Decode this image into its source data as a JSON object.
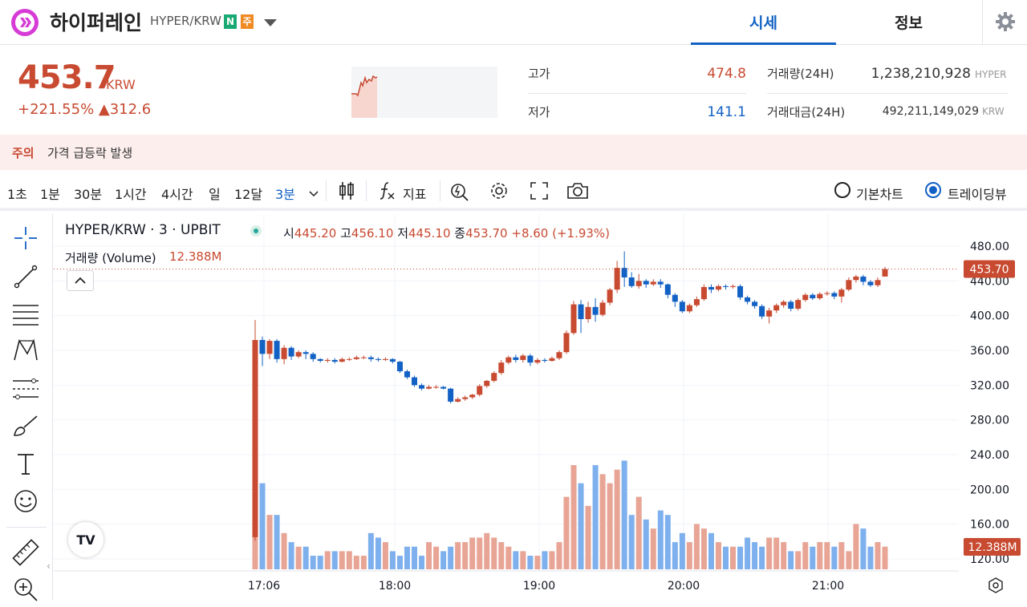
{
  "header": {
    "coin_name": "하이퍼레인",
    "pair": "HYPER/KRW",
    "badge_n": "N",
    "badge_j": "주",
    "tab_price": "시세",
    "tab_info": "정보",
    "brand_color": "#d63bd6",
    "accent_color": "#1261c4"
  },
  "summary": {
    "price": "453.7",
    "price_unit": "KRW",
    "change": "+221.55% ▲312.6",
    "high_label": "고가",
    "high_value": "474.8",
    "low_label": "저가",
    "low_value": "141.1",
    "volume_label": "거래량(24H)",
    "volume_value": "1,238,210,928",
    "volume_unit": "HYPER",
    "amount_label": "거래대금(24H)",
    "amount_value": "492,211,149,029",
    "amount_unit": "KRW",
    "up_color": "#c84a31",
    "down_color": "#1261c4"
  },
  "warning": {
    "title": "주의",
    "text": "가격 급등락 발생"
  },
  "toolbar": {
    "timeframes": [
      "1초",
      "1분",
      "30분",
      "1시간",
      "4시간",
      "일",
      "12달",
      "3분"
    ],
    "indicator_label": "지표",
    "basic_chart": "기본차트",
    "trading_view": "트레이딩뷰",
    "icons": [
      "candle-type-icon",
      "function-icon",
      "compare-icon",
      "gear-icon",
      "fullscreen-icon",
      "camera-icon"
    ]
  },
  "left_tools": [
    "crosshair-icon",
    "trendline-icon",
    "fib-lines-icon",
    "pattern-icon",
    "projection-icon",
    "brush-icon",
    "text-icon",
    "emoji-icon",
    "ruler-icon",
    "zoom-icon"
  ],
  "legend": {
    "symbol": "HYPER/KRW · 3 · UPBIT",
    "open_label": "시",
    "open": "445.20",
    "high_label": "고",
    "high": "456.10",
    "low_label": "저",
    "low": "445.10",
    "close_label": "종",
    "close": "453.70",
    "change": "+8.60 (+1.93%)",
    "volume_label": "거래량 (Volume)",
    "volume_value": "12.388M"
  },
  "chart_data": {
    "type": "candlestick",
    "x_ticks": [
      "17:06",
      "18:00",
      "19:00",
      "20:00",
      "21:00"
    ],
    "y_ticks": [
      "480.00",
      "440.00",
      "400.00",
      "360.00",
      "320.00",
      "280.00",
      "240.00",
      "200.00",
      "160.00",
      "120.00"
    ],
    "ylim": [
      110,
      490
    ],
    "last_price_label": "453.70",
    "last_price": 453.7,
    "last_volume_label": "12.388M",
    "up_color": "#c84a31",
    "down_color": "#1261c4",
    "candles": [
      [
        145,
        372,
        395,
        141
      ],
      [
        372,
        356,
        376,
        342
      ],
      [
        356,
        371,
        373,
        350
      ],
      [
        371,
        350,
        373,
        346
      ],
      [
        350,
        363,
        366,
        344
      ],
      [
        363,
        353,
        365,
        349
      ],
      [
        353,
        358,
        360,
        351
      ],
      [
        358,
        356,
        360,
        350
      ],
      [
        356,
        350,
        358,
        347
      ],
      [
        350,
        348,
        351,
        346
      ],
      [
        348,
        349,
        351,
        346
      ],
      [
        349,
        347,
        351,
        345
      ],
      [
        347,
        350,
        352,
        346
      ],
      [
        350,
        350,
        352,
        348
      ],
      [
        350,
        352,
        354,
        349
      ],
      [
        352,
        352,
        354,
        350
      ],
      [
        352,
        350,
        354,
        347
      ],
      [
        350,
        349,
        352,
        347
      ],
      [
        349,
        350,
        352,
        348
      ],
      [
        350,
        347,
        351,
        345
      ],
      [
        347,
        336,
        348,
        334
      ],
      [
        336,
        329,
        338,
        327
      ],
      [
        329,
        320,
        331,
        318
      ],
      [
        320,
        316,
        322,
        314
      ],
      [
        316,
        318,
        320,
        315
      ],
      [
        318,
        318,
        320,
        316
      ],
      [
        318,
        316,
        319,
        315
      ],
      [
        316,
        301,
        317,
        299
      ],
      [
        301,
        304,
        306,
        300
      ],
      [
        304,
        306,
        308,
        302
      ],
      [
        306,
        309,
        310,
        304
      ],
      [
        309,
        319,
        321,
        307
      ],
      [
        319,
        325,
        326,
        317
      ],
      [
        325,
        334,
        336,
        323
      ],
      [
        334,
        346,
        349,
        332
      ],
      [
        346,
        352,
        354,
        344
      ],
      [
        352,
        349,
        355,
        346
      ],
      [
        349,
        354,
        356,
        346
      ],
      [
        354,
        346,
        356,
        342
      ],
      [
        346,
        349,
        351,
        344
      ],
      [
        349,
        348,
        351,
        346
      ],
      [
        348,
        351,
        353,
        347
      ],
      [
        351,
        358,
        360,
        349
      ],
      [
        358,
        380,
        383,
        356
      ],
      [
        380,
        413,
        417,
        378
      ],
      [
        413,
        396,
        418,
        380
      ],
      [
        396,
        410,
        416,
        392
      ],
      [
        410,
        401,
        420,
        393
      ],
      [
        401,
        415,
        418,
        399
      ],
      [
        415,
        430,
        432,
        412
      ],
      [
        430,
        455,
        463,
        426
      ],
      [
        455,
        444,
        474,
        433
      ],
      [
        444,
        434,
        450,
        432
      ],
      [
        434,
        440,
        448,
        431
      ],
      [
        440,
        436,
        442,
        432
      ],
      [
        436,
        439,
        442,
        434
      ],
      [
        439,
        436,
        442,
        432
      ],
      [
        436,
        424,
        437,
        420
      ],
      [
        424,
        416,
        426,
        410
      ],
      [
        416,
        405,
        418,
        403
      ],
      [
        405,
        412,
        414,
        403
      ],
      [
        412,
        419,
        422,
        410
      ],
      [
        419,
        433,
        436,
        417
      ],
      [
        433,
        430,
        436,
        426
      ],
      [
        430,
        434,
        436,
        428
      ],
      [
        434,
        433,
        436,
        430
      ],
      [
        433,
        434,
        436,
        431
      ],
      [
        434,
        421,
        436,
        418
      ],
      [
        421,
        416,
        423,
        413
      ],
      [
        416,
        411,
        418,
        408
      ],
      [
        411,
        399,
        413,
        396
      ],
      [
        399,
        406,
        409,
        391
      ],
      [
        406,
        412,
        414,
        403
      ],
      [
        412,
        416,
        418,
        409
      ],
      [
        416,
        408,
        418,
        405
      ],
      [
        408,
        418,
        420,
        406
      ],
      [
        418,
        424,
        426,
        416
      ],
      [
        424,
        420,
        426,
        418
      ],
      [
        420,
        425,
        427,
        418
      ],
      [
        425,
        426,
        428,
        423
      ],
      [
        426,
        422,
        428,
        419
      ],
      [
        422,
        430,
        432,
        415
      ],
      [
        430,
        441,
        444,
        428
      ],
      [
        441,
        445,
        447,
        438
      ],
      [
        445,
        439,
        447,
        435
      ],
      [
        439,
        435,
        441,
        433
      ],
      [
        435,
        441,
        444,
        433
      ],
      [
        445,
        453.7,
        456,
        445
      ]
    ],
    "volume_ylim": [
      0,
      20
    ],
    "volumes": [
      8,
      19,
      12,
      12,
      8,
      6,
      5,
      5,
      3,
      3,
      4,
      4,
      4,
      4,
      3,
      3,
      8,
      7,
      6,
      4,
      3,
      5,
      5,
      3,
      6,
      5,
      4,
      5,
      6,
      6,
      7,
      7,
      8,
      7,
      6,
      5,
      4,
      4,
      3,
      3,
      4,
      4,
      6,
      16,
      23,
      19,
      14,
      23,
      21,
      19,
      22,
      24,
      12,
      16,
      11,
      9,
      13,
      12,
      6,
      8,
      6,
      10,
      9,
      8,
      6,
      5,
      5,
      5,
      7,
      6,
      5,
      7,
      7,
      6,
      4,
      4,
      6,
      5,
      6,
      6,
      5,
      6,
      4,
      10,
      9,
      5,
      6,
      5
    ]
  }
}
